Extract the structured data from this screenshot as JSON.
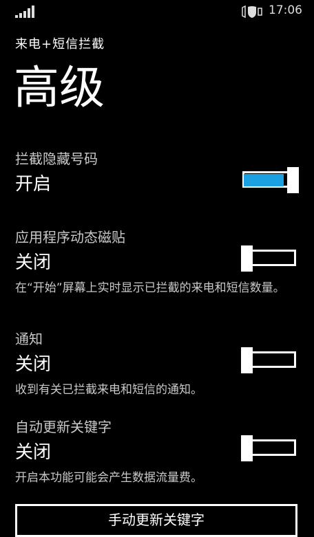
{
  "status_bar": {
    "time": "17:06",
    "signal_icon": "signal-bars-icon",
    "battery_icon": "battery-shield-icon"
  },
  "app_title": "来电+短信拦截",
  "page_title": "高级",
  "settings": [
    {
      "label": "拦截隐藏号码",
      "state": "开启",
      "on": true,
      "desc": ""
    },
    {
      "label": "应用程序动态磁贴",
      "state": "关闭",
      "on": false,
      "desc": "在“开始”屏幕上实时显示已拦截的来电和短信数量。"
    },
    {
      "label": "通知",
      "state": "关闭",
      "on": false,
      "desc": "收到有关已拦截来电和短信的通知。"
    },
    {
      "label": "自动更新关键字",
      "state": "关闭",
      "on": false,
      "desc": "开启本功能可能会产生数据流量费。"
    }
  ],
  "update_button": "手动更新关键字",
  "colors": {
    "accent": "#1ba1e2",
    "background": "#000000",
    "text": "#ffffff",
    "subtle": "#c9c9c9"
  }
}
